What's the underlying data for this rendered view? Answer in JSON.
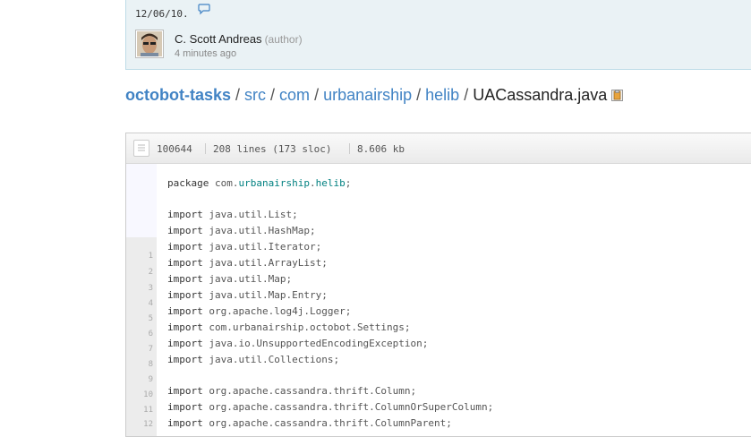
{
  "commit": {
    "date": "12/06/10.",
    "author_name": "C. Scott Andreas",
    "author_role": "(author)",
    "time_ago": "4 minutes ago"
  },
  "breadcrumb": {
    "repo": "octobot-tasks",
    "path": [
      "src",
      "com",
      "urbanairship",
      "helib"
    ],
    "file": "UACassandra.java"
  },
  "file_info": {
    "mode": "100644",
    "lines": "208 lines (173 sloc)",
    "size": "8.606 kb"
  },
  "line_numbers": [
    "1",
    "2",
    "3",
    "4",
    "5",
    "6",
    "7",
    "8",
    "9",
    "10",
    "11",
    "12"
  ],
  "code": {
    "package_kw": "package",
    "package_prefix": "com.",
    "package_hl1": "urbanairship",
    "package_dot": ".",
    "package_hl2": "helib",
    "package_end": ";",
    "import_kw": "import",
    "imports": [
      "java.util.List;",
      "java.util.HashMap;",
      "java.util.Iterator;",
      "java.util.ArrayList;",
      "java.util.Map;",
      "java.util.Map.Entry;",
      "org.apache.log4j.Logger;",
      "com.urbanairship.octobot.Settings;",
      "java.io.UnsupportedEncodingException;",
      "java.util.Collections;",
      "org.apache.cassandra.thrift.Column;",
      "org.apache.cassandra.thrift.ColumnOrSuperColumn;",
      "org.apache.cassandra.thrift.ColumnParent;"
    ]
  },
  "colors": {
    "link": "#4183c4",
    "highlight": "#008080"
  },
  "icons": [
    "comment-icon",
    "clipboard-icon",
    "file-icon"
  ]
}
